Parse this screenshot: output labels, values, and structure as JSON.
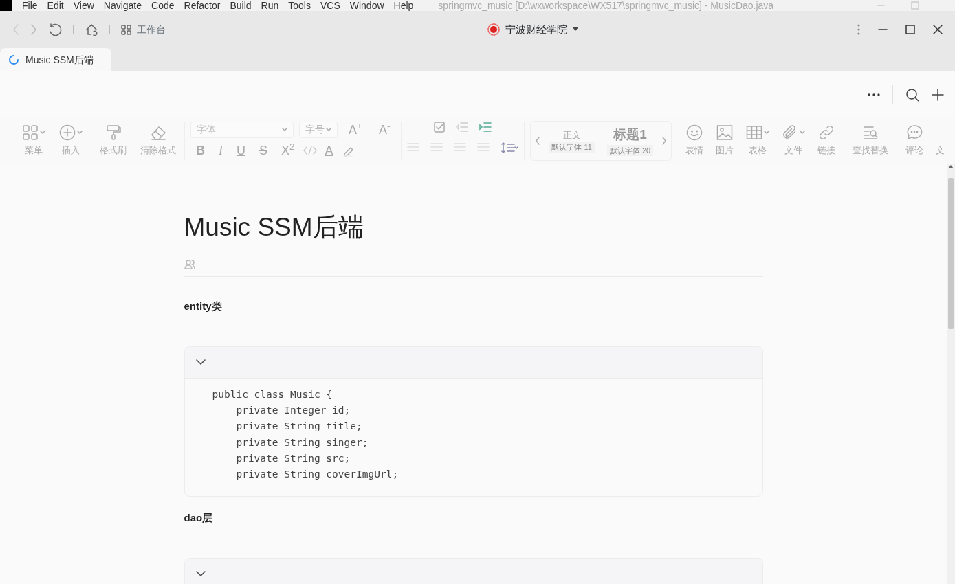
{
  "ide": {
    "menu": [
      "File",
      "Edit",
      "View",
      "Navigate",
      "Code",
      "Refactor",
      "Build",
      "Run",
      "Tools",
      "VCS",
      "Window",
      "Help"
    ],
    "title": "springmvc_music [D:\\wxworkspace\\WX517\\springmvc_music] - MusicDao.java"
  },
  "app_bar": {
    "workbench": "工作台",
    "org": "宁波财经学院"
  },
  "tabs": [
    {
      "label": "Music SSM后端",
      "selected": true
    }
  ],
  "toolbar": {
    "left_tools": [
      {
        "label": "菜单",
        "dropdown": true
      },
      {
        "label": "插入",
        "dropdown": true
      },
      {
        "label": "格式刷",
        "dropdown": false
      },
      {
        "label": "清除格式",
        "dropdown": false
      }
    ],
    "font_placeholder": "字体",
    "size_placeholder": "字号",
    "size_buttons": [
      "A$^{+}$",
      "A$^{-}$"
    ],
    "format_buttons": [
      "B",
      "I",
      "U",
      "S",
      "X$^{2}$"
    ],
    "text_color": "A",
    "styles": [
      {
        "kind": "body",
        "name": "正文",
        "font": "默认字体 11"
      },
      {
        "kind": "heading",
        "name": "标题1",
        "font": "默认字体 20"
      }
    ],
    "right_tools": [
      {
        "label": "表情",
        "dropdown": false
      },
      {
        "label": "图片",
        "dropdown": false
      },
      {
        "label": "表格",
        "dropdown": true
      },
      {
        "label": "文件",
        "dropdown": true
      },
      {
        "label": "链接",
        "dropdown": false
      },
      {
        "label": "查找替换",
        "dropdown": false
      },
      {
        "label": "评论",
        "dropdown": false
      },
      {
        "label": "文",
        "dropdown": false
      }
    ]
  },
  "doc": {
    "title": "Music SSM后端",
    "blocks": [
      {
        "kind": "heading",
        "text": "entity类"
      },
      {
        "kind": "code",
        "expanded": true,
        "lines": [
          "public class Music {",
          "    private Integer id;",
          "    private String title;",
          "    private String singer;",
          "    private String src;",
          "    private String coverImgUrl;"
        ]
      },
      {
        "kind": "heading",
        "text": "dao层"
      },
      {
        "kind": "code",
        "expanded": true
      }
    ]
  }
}
